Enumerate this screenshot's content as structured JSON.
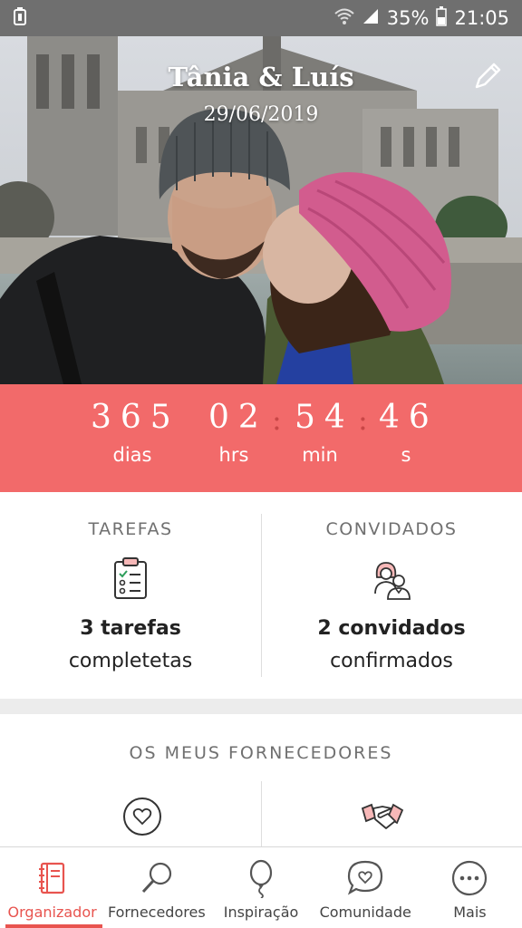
{
  "status_bar": {
    "battery_percent": "35%",
    "time": "21:05"
  },
  "hero": {
    "title": "Tânia & Luís",
    "date": "29/06/2019",
    "edit_icon": "pencil-icon"
  },
  "countdown": {
    "days": "365",
    "hours": "02",
    "minutes": "54",
    "seconds": "46",
    "days_label": "dias",
    "hours_label": "hrs",
    "minutes_label": "min",
    "seconds_label": "s",
    "background_color": "#f26a6a"
  },
  "tasks": {
    "heading": "TAREFAS",
    "count_text": "3 tarefas",
    "sub_text": "completetas",
    "icon": "clipboard-checklist-icon"
  },
  "guests": {
    "heading": "CONVIDADOS",
    "count_text": "2 convidados",
    "sub_text": "confirmados",
    "icon": "couple-icon"
  },
  "suppliers": {
    "heading": "OS MEUS FORNECEDORES",
    "left_icon": "heart-circle-icon",
    "right_icon": "handshake-icon"
  },
  "bottom_nav": {
    "items": [
      {
        "label": "Organizador",
        "icon": "planner-book-icon",
        "active": true
      },
      {
        "label": "Fornecedores",
        "icon": "magnifier-icon",
        "active": false
      },
      {
        "label": "Inspiração",
        "icon": "balloon-icon",
        "active": false
      },
      {
        "label": "Comunidade",
        "icon": "chat-heart-icon",
        "active": false
      },
      {
        "label": "Mais",
        "icon": "more-dots-icon",
        "active": false
      }
    ],
    "accent_color": "#e8544f"
  }
}
